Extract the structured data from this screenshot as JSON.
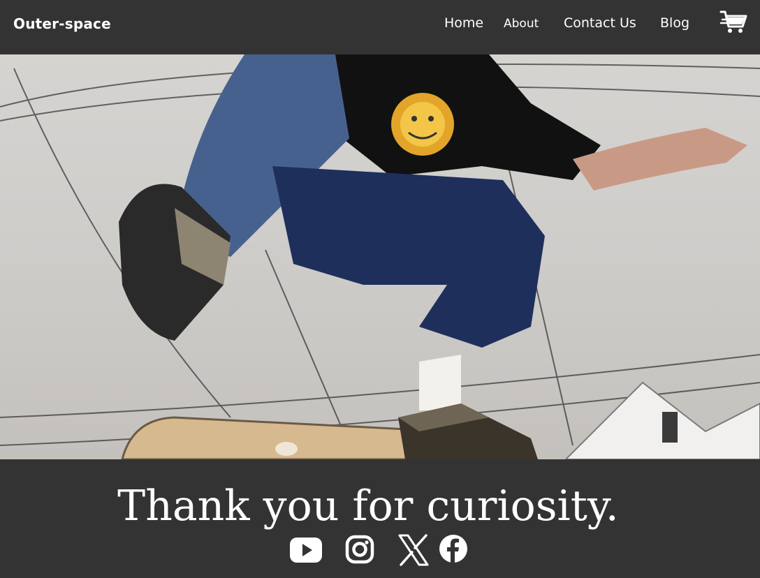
{
  "nav": {
    "brand": "Outer-space",
    "links": [
      {
        "label": "Home"
      },
      {
        "label": "About"
      },
      {
        "label": "Contact Us"
      },
      {
        "label": "Blog"
      }
    ],
    "cart_icon": "shopping-cart-icon"
  },
  "hero": {
    "image": "skateboarder-kickflip-photo"
  },
  "footer": {
    "message": "Thank you for curiosity.",
    "socials": [
      {
        "name": "youtube-icon"
      },
      {
        "name": "instagram-icon"
      },
      {
        "name": "x-icon"
      },
      {
        "name": "facebook-icon"
      }
    ]
  },
  "colors": {
    "background": "#333333",
    "text": "#ffffff"
  }
}
